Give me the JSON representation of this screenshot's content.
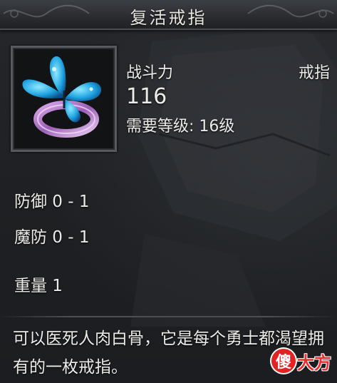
{
  "tooltip": {
    "title": "复活戒指",
    "stat_label": "战斗力",
    "item_type": "戒指",
    "power": "116",
    "required_level": "需要等级: 16级",
    "attributes": [
      "防御 0 - 1",
      "魔防 0 - 1",
      "重量 1"
    ],
    "description": "可以医死人肉白骨，它是每个勇士都渴望拥有的一枚戒指。",
    "item_icon": "butterfly-ring-icon"
  },
  "watermark": {
    "badge": "傻",
    "text": "大方"
  },
  "colors": {
    "text": "#ecebe7",
    "background": "#1e2023",
    "title_bar": "#2b2d31",
    "watermark": "#e02424"
  }
}
